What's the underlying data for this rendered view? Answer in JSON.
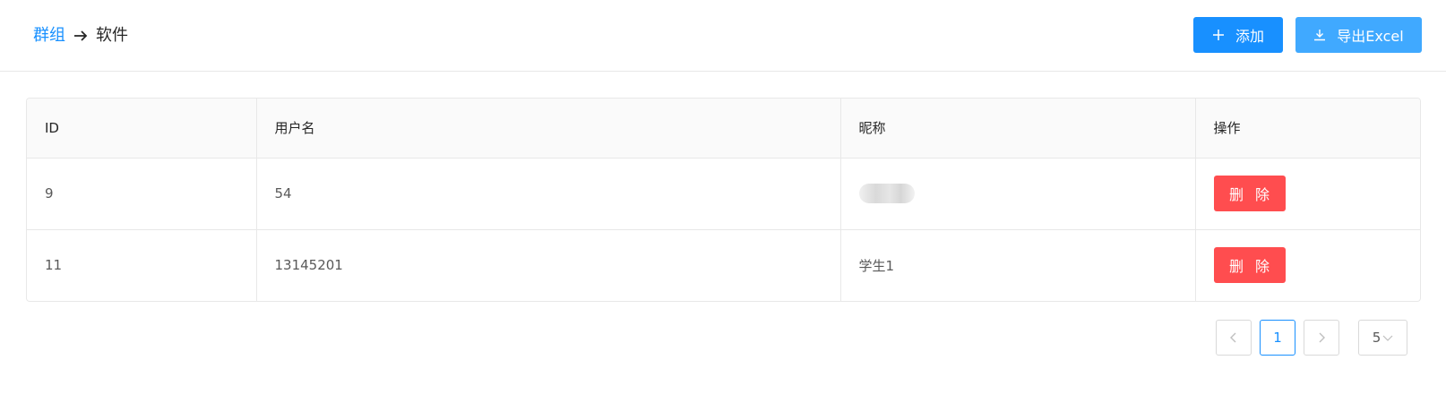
{
  "breadcrumb": {
    "parent": "群组",
    "current": "软件"
  },
  "toolbar": {
    "add_label": "添加",
    "export_label": "导出Excel"
  },
  "table": {
    "headers": [
      "ID",
      "用户名",
      "昵称",
      "操作"
    ],
    "rows": [
      {
        "id": "9",
        "username": "54",
        "nickname": "",
        "action": "删 除"
      },
      {
        "id": "11",
        "username": "13145201",
        "nickname": "学生1",
        "action": "删 除"
      }
    ]
  },
  "pagination": {
    "current_page": "1",
    "page_size": "5"
  },
  "colors": {
    "primary": "#1890ff",
    "export": "#40a9ff",
    "danger": "#ff4d4f"
  },
  "icons": {
    "add": "plus-icon",
    "export": "download-icon",
    "prev": "chevron-left-icon",
    "next": "chevron-right-icon",
    "size": "chevron-down-icon"
  }
}
